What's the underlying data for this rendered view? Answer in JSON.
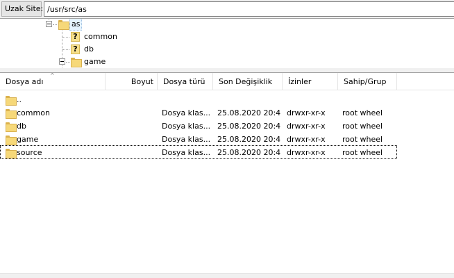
{
  "path_bar": {
    "label": "Uzak Site:",
    "value": "/usr/src/as"
  },
  "tree": {
    "nodes": [
      {
        "label": "as",
        "icon": "folder-icon",
        "expanded": true,
        "selected": true
      },
      {
        "label": "common",
        "icon": "unknown-folder-icon"
      },
      {
        "label": "db",
        "icon": "unknown-folder-icon"
      },
      {
        "label": "game",
        "icon": "folder-icon",
        "expanded": true
      }
    ]
  },
  "list": {
    "columns": [
      "Dosya adı",
      "Boyut",
      "Dosya türü",
      "Son Değişiklik",
      "İzinler",
      "Sahip/Grup"
    ],
    "sort_indicator": "^",
    "rows": [
      {
        "name": "..",
        "size": "",
        "type": "",
        "modified": "",
        "perms": "",
        "owner": ""
      },
      {
        "name": "common",
        "size": "",
        "type": "Dosya klas...",
        "modified": "25.08.2020 20:4...",
        "perms": "drwxr-xr-x",
        "owner": "root wheel"
      },
      {
        "name": "db",
        "size": "",
        "type": "Dosya klas...",
        "modified": "25.08.2020 20:4...",
        "perms": "drwxr-xr-x",
        "owner": "root wheel"
      },
      {
        "name": "game",
        "size": "",
        "type": "Dosya klas...",
        "modified": "25.08.2020 20:4...",
        "perms": "drwxr-xr-x",
        "owner": "root wheel"
      },
      {
        "name": "source",
        "size": "",
        "type": "Dosya klas...",
        "modified": "25.08.2020 20:4...",
        "perms": "drwxr-xr-x",
        "owner": "root wheel"
      }
    ]
  },
  "colors": {
    "folder": "#f6d879",
    "selection": "#e5f3ff",
    "border": "#a0a0a0"
  }
}
